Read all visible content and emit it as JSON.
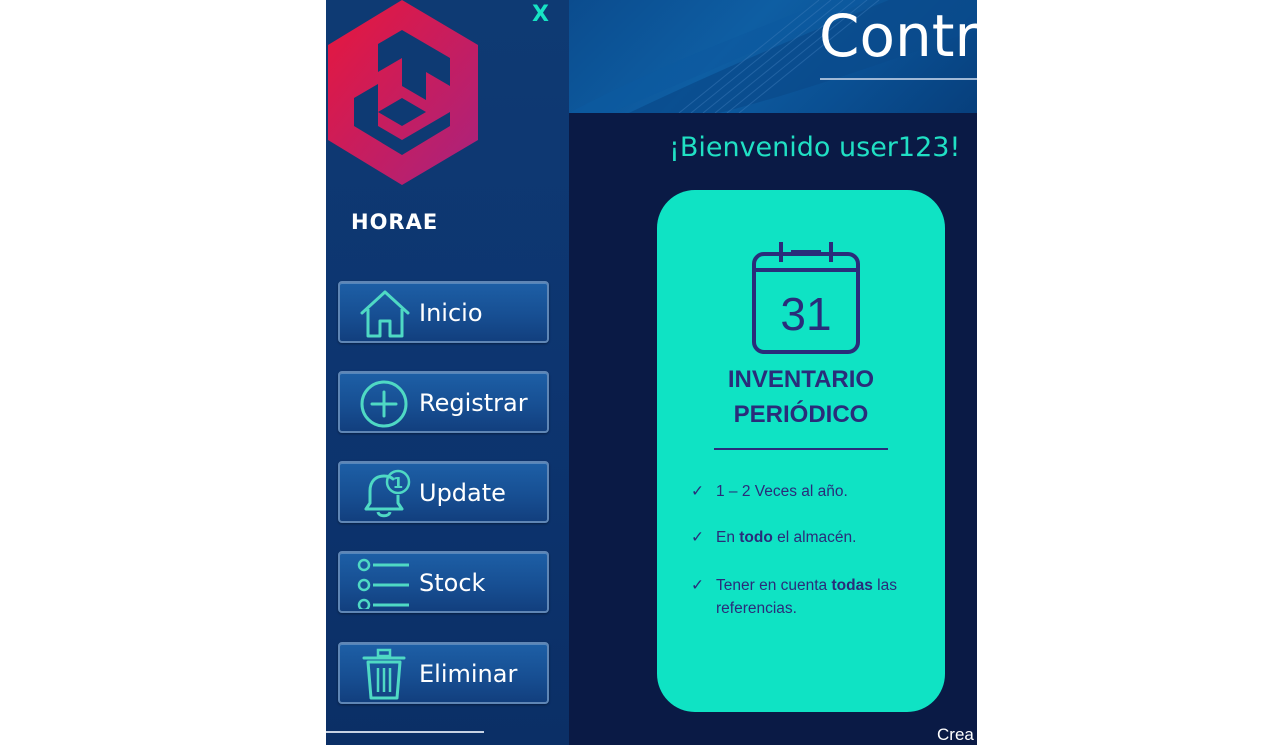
{
  "window": {
    "close_label": "X"
  },
  "sidebar": {
    "brand": "HORAE",
    "items": [
      {
        "label": "Inicio",
        "icon": "home-icon"
      },
      {
        "label": "Registrar",
        "icon": "plus-circle-icon"
      },
      {
        "label": "Update",
        "icon": "bell-icon",
        "badge": "1"
      },
      {
        "label": "Stock",
        "icon": "list-icon"
      },
      {
        "label": "Eliminar",
        "icon": "trash-icon"
      }
    ]
  },
  "header": {
    "title": "Contro"
  },
  "main": {
    "welcome": "¡Bienvenido user123!",
    "card": {
      "calendar_day": "31",
      "title_line1": "INVENTARIO",
      "title_line2": "PERIÓDICO",
      "items": [
        {
          "pre": "1 – 2 Veces al año.",
          "bold": "",
          "post": ""
        },
        {
          "pre": "En ",
          "bold": "todo",
          "post": " el almacén."
        },
        {
          "pre": "Tener en cuenta ",
          "bold": "todas",
          "post": " las referencias."
        }
      ]
    },
    "footer_text": "Crea"
  },
  "colors": {
    "sidebar": "#0e3a73",
    "main_bg": "#0a1a45",
    "accent": "#20e0c4",
    "card": "#0fe3c4",
    "card_text": "#2a2c7a",
    "logo_red": "#e8173c",
    "logo_magenta": "#b0237e"
  }
}
